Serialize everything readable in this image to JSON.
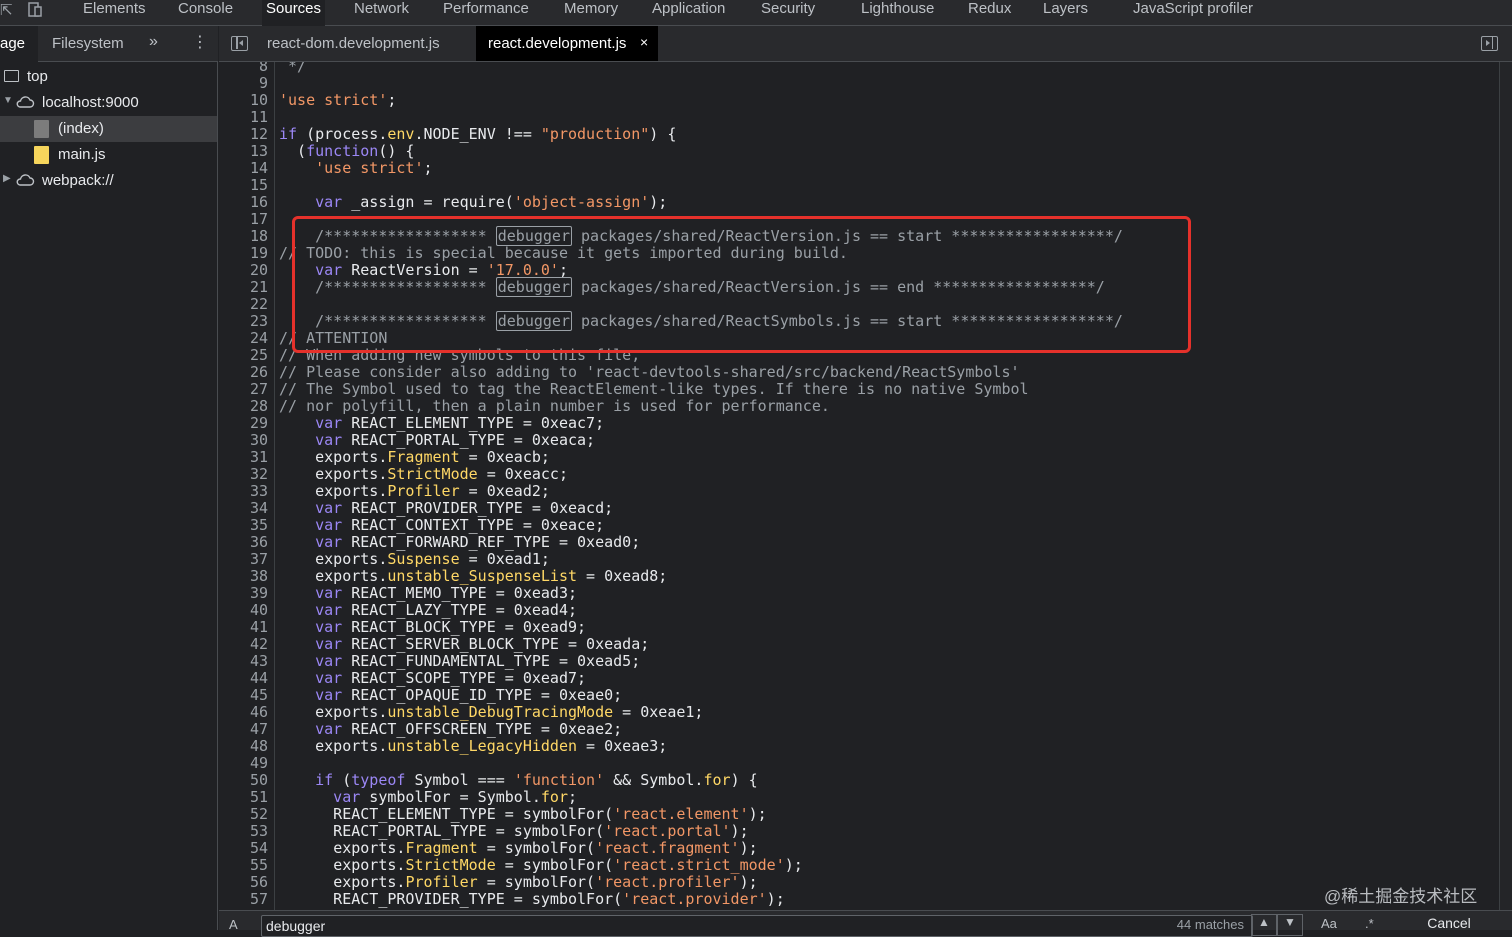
{
  "main_tabs": [
    {
      "label": "Elements"
    },
    {
      "label": "Console"
    },
    {
      "label": "Sources"
    },
    {
      "label": "Network"
    },
    {
      "label": "Performance"
    },
    {
      "label": "Memory"
    },
    {
      "label": "Application"
    },
    {
      "label": "Security"
    },
    {
      "label": "Lighthouse"
    },
    {
      "label": "Redux"
    },
    {
      "label": "Layers"
    },
    {
      "label": "JavaScript profiler"
    }
  ],
  "active_main_tab": "Sources",
  "navigator": {
    "tabs": [
      {
        "label": "age"
      },
      {
        "label": "Filesystem"
      }
    ],
    "more_label": "»",
    "kebab_label": "⋮",
    "tree": [
      {
        "label": "top",
        "icon": "frame-icon"
      },
      {
        "label": "localhost:9000",
        "icon": "cloud-icon",
        "expanded": true
      },
      {
        "label": "(index)",
        "icon": "document-file-icon",
        "selected": true
      },
      {
        "label": "main.js",
        "icon": "script-file-icon"
      },
      {
        "label": "webpack://",
        "icon": "cloud-icon",
        "expanded": false
      }
    ]
  },
  "editor_tabs": [
    {
      "label": "react-dom.development.js"
    },
    {
      "label": "react.development.js",
      "active": true,
      "close": "×"
    }
  ],
  "code": {
    "line_numbers": [
      "8",
      "9",
      "10",
      "11",
      "12",
      "13",
      "14",
      "15",
      "16",
      "17",
      "18",
      "19",
      "20",
      "21",
      "22",
      "23",
      "24",
      "25",
      "26",
      "27",
      "28",
      "29",
      "30",
      "31",
      "32",
      "33",
      "34",
      "35",
      "36",
      "37",
      "38",
      "39",
      "40",
      "41",
      "42",
      "43",
      "44",
      "45",
      "46",
      "47",
      "48",
      "49",
      "50",
      "51",
      "52",
      "53",
      "54",
      "55",
      "56",
      "57"
    ],
    "l8": " */",
    "l10_str": "'use strict'",
    "l10_end": ";",
    "l12_if": "if",
    "l12_a": " (process.",
    "l12_env": "env",
    "l12_b": ".NODE_ENV !== ",
    "l12_prod": "\"production\"",
    "l12_c": ") {",
    "l13_a": "  (",
    "l13_fn": "function",
    "l13_b": "() {",
    "l14_str": "    'use strict'",
    "l14_end": ";",
    "l16_var": "    var",
    "l16_a": " _assign = require(",
    "l16_str": "'object-assign'",
    "l16_b": ");",
    "l18_a": "    /****************** ",
    "l18_dbg": "debugger",
    "l18_b": " packages/shared/ReactVersion.js == start ******************/",
    "l19": "// TODO: this is special because it gets imported during build.",
    "l20_var": "    var",
    "l20_a": " ReactVersion = ",
    "l20_str": "'17.0.0'",
    "l20_b": ";",
    "l21_a": "    /****************** ",
    "l21_dbg": "debugger",
    "l21_b": " packages/shared/ReactVersion.js == end ******************/",
    "l23_a": "    /****************** ",
    "l23_dbg": "debugger",
    "l23_b": " packages/shared/ReactSymbols.js == start ******************/",
    "l24": "// ATTENTION",
    "l25": "// When adding new symbols to this file,",
    "l26": "// Please consider also adding to 'react-devtools-shared/src/backend/ReactSymbols'",
    "l27": "// The Symbol used to tag the ReactElement-like types. If there is no native Symbol",
    "l28": "// nor polyfill, then a plain number is used for performance.",
    "l29_rest": " REACT_ELEMENT_TYPE = 0xeac7;",
    "l30_rest": " REACT_PORTAL_TYPE = 0xeaca;",
    "l31_p": "Fragment",
    "l31_rest": " = 0xeacb;",
    "l32_p": "StrictMode",
    "l32_rest": " = 0xeacc;",
    "l33_p": "Profiler",
    "l33_rest": " = 0xead2;",
    "l34_rest": " REACT_PROVIDER_TYPE = 0xeacd;",
    "l35_rest": " REACT_CONTEXT_TYPE = 0xeace;",
    "l36_rest": " REACT_FORWARD_REF_TYPE = 0xead0;",
    "l37_p": "Suspense",
    "l37_rest": " = 0xead1;",
    "l38_p": "unstable_SuspenseList",
    "l38_rest": " = 0xead8;",
    "l39_rest": " REACT_MEMO_TYPE = 0xead3;",
    "l40_rest": " REACT_LAZY_TYPE = 0xead4;",
    "l41_rest": " REACT_BLOCK_TYPE = 0xead9;",
    "l42_rest": " REACT_SERVER_BLOCK_TYPE = 0xeada;",
    "l43_rest": " REACT_FUNDAMENTAL_TYPE = 0xead5;",
    "l44_rest": " REACT_SCOPE_TYPE = 0xead7;",
    "l45_rest": " REACT_OPAQUE_ID_TYPE = 0xeae0;",
    "l46_p": "unstable_DebugTracingMode",
    "l46_rest": " = 0xeae1;",
    "l47_rest": " REACT_OFFSCREEN_TYPE = 0xeae2;",
    "l48_p": "unstable_LegacyHidden",
    "l48_rest": " = 0xeae3;",
    "l50_if": "    if",
    "l50_a": " (",
    "l50_typeof": "typeof",
    "l50_b": " Symbol === ",
    "l50_str": "'function'",
    "l50_c": " && Symbol.",
    "l50_for": "for",
    "l50_d": ") {",
    "l51_var": "      var",
    "l51_a": " symbolFor = Symbol.",
    "l51_for": "for",
    "l51_b": ";",
    "l52_a": "      REACT_ELEMENT_TYPE = symbolFor(",
    "l52_s": "'react.element'",
    "l52_b": ");",
    "l53_a": "      REACT_PORTAL_TYPE = symbolFor(",
    "l53_s": "'react.portal'",
    "l53_b": ");",
    "l54_p": "Fragment",
    "l54_a": " = symbolFor(",
    "l54_s": "'react.fragment'",
    "l54_b": ");",
    "l55_p": "StrictMode",
    "l55_a": " = symbolFor(",
    "l55_s": "'react.strict_mode'",
    "l55_b": ");",
    "l56_p": "Profiler",
    "l56_a": " = symbolFor(",
    "l56_s": "'react.profiler'",
    "l56_b": ");",
    "l57_a": "      REACT_PROVIDER_TYPE = symbolFor(",
    "l57_s": "'react.provider'",
    "l57_b": ");",
    "kw_var": "var",
    "kw_exports": "exports.",
    "indent4": "    ",
    "indent6": "      "
  },
  "search": {
    "value": "debugger",
    "matches": "44 matches",
    "up": "▲",
    "down": "▼",
    "case_label": "Aa",
    "regex_label": ".*",
    "cancel": "Cancel"
  },
  "watermark": "@稀土掘金技术社区",
  "colors": {
    "highlight_box": "#e5312b",
    "keyword": "#9b87f5",
    "string": "#f29766",
    "property": "#ffd866",
    "comment": "#9aa0a6"
  }
}
